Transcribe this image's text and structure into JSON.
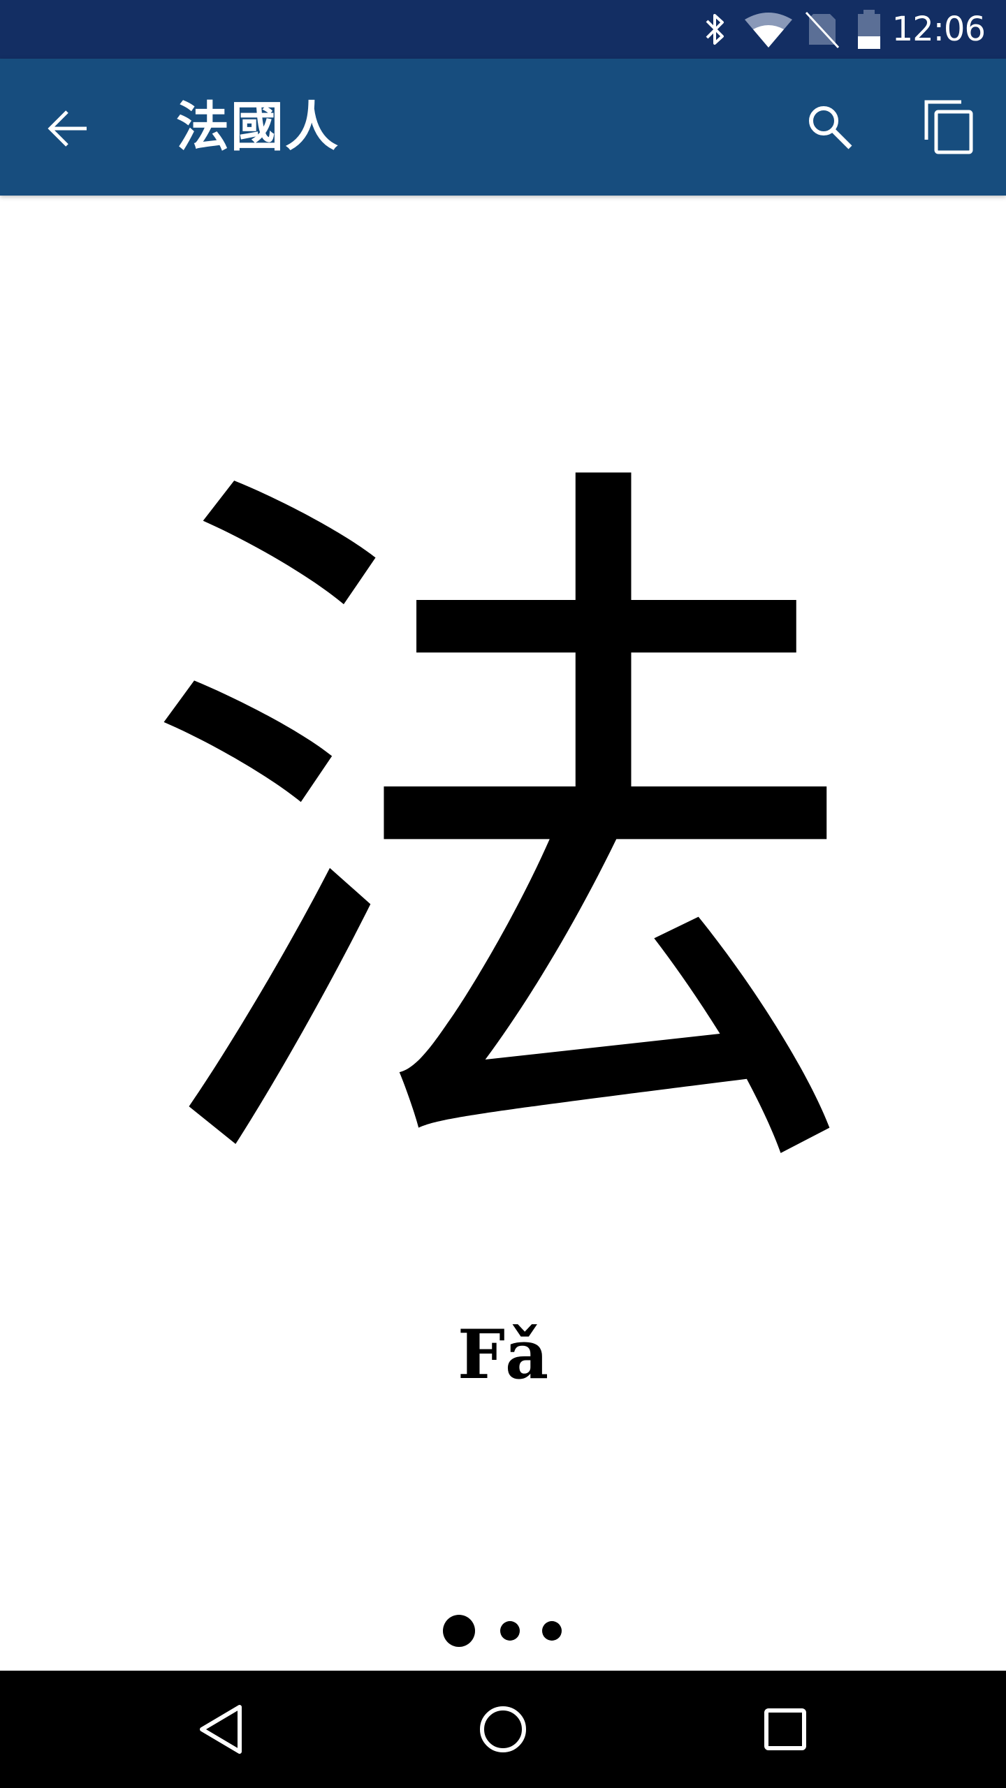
{
  "status_bar": {
    "time": "12:06",
    "icons": [
      "bluetooth-icon",
      "wifi-icon",
      "no-sim-icon",
      "battery-icon"
    ]
  },
  "app_bar": {
    "title": "法國人",
    "back_icon": "arrow-left-icon",
    "search_icon": "search-icon",
    "copy_icon": "copy-icon"
  },
  "content": {
    "character": "法",
    "pinyin": "Fǎ"
  },
  "page_indicator": {
    "total_pages": 3,
    "current_page": 1
  },
  "nav_bar": {
    "buttons": [
      "back-triangle-icon",
      "home-circle-icon",
      "recents-square-icon"
    ]
  },
  "colors": {
    "status_bar_bg": "#132e63",
    "app_bar_bg": "#174d7e",
    "content_bg": "#ffffff",
    "nav_bar_bg": "#000000"
  }
}
